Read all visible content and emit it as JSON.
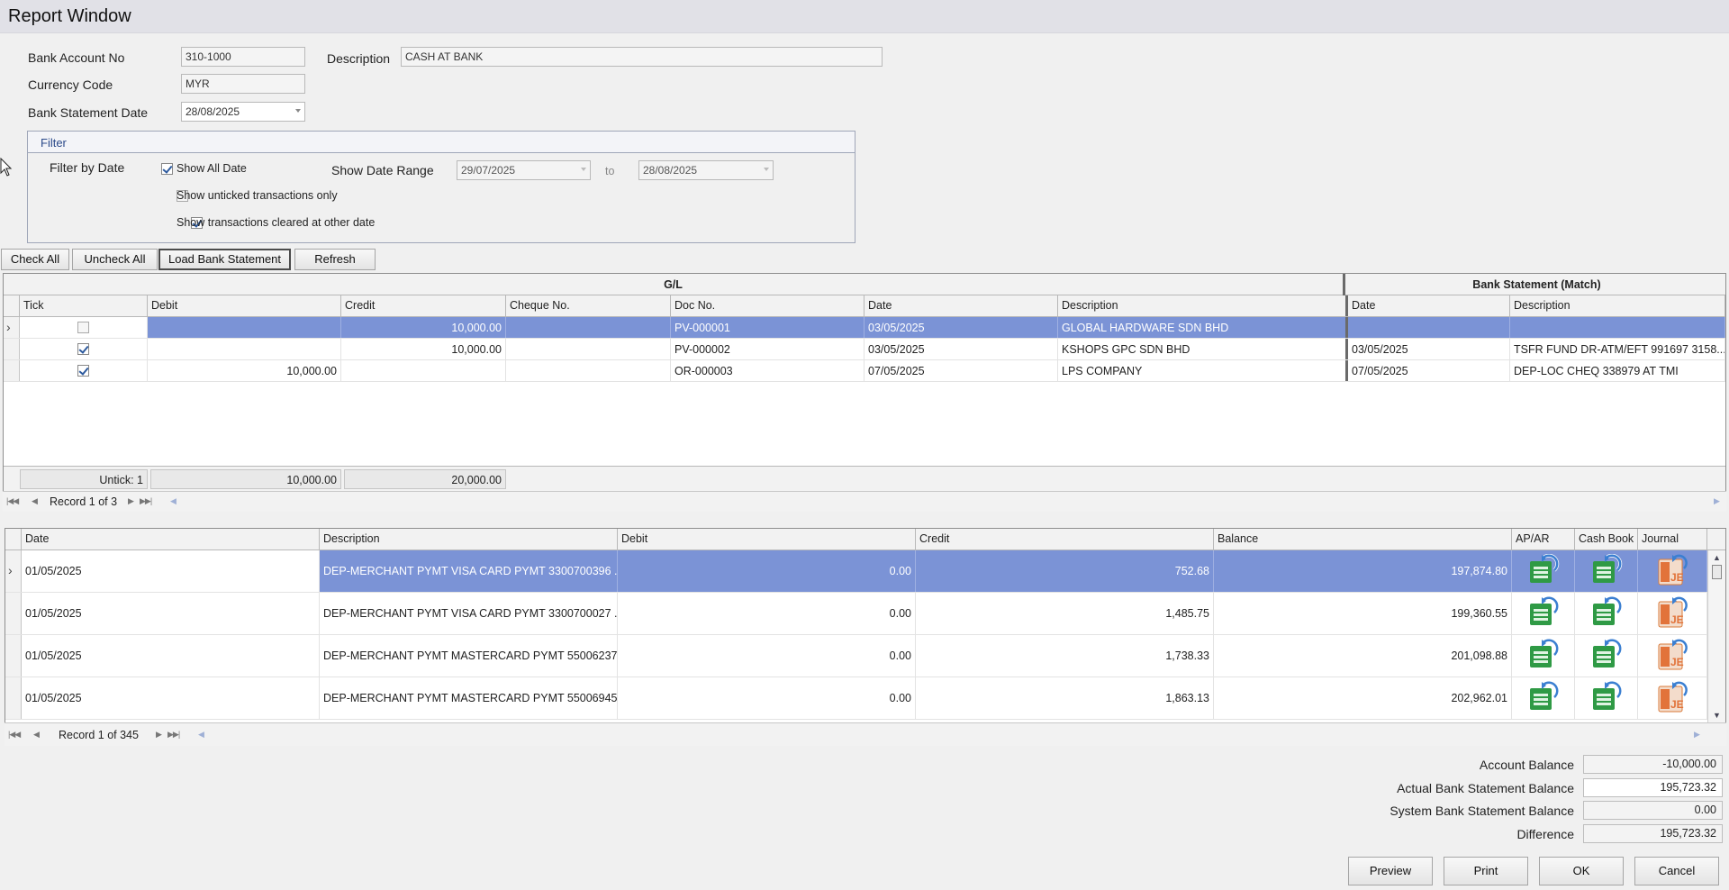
{
  "window": {
    "title": "Report   Window"
  },
  "header": {
    "bank_account_label": "Bank Account No",
    "bank_account_value": "310-1000",
    "description_label": "Description",
    "description_value": "CASH AT BANK",
    "currency_label": "Currency Code",
    "currency_value": "MYR",
    "statement_date_label": "Bank Statement Date",
    "statement_date_value": "28/08/2025"
  },
  "filter": {
    "title": "Filter",
    "filter_by_date_label": "Filter by Date",
    "show_all_date_label": "Show All Date",
    "show_all_date_checked": true,
    "show_date_range_label": "Show Date Range",
    "date_from": "29/07/2025",
    "to_label": "to",
    "date_to": "28/08/2025",
    "show_unticked_label": "Show unticked transactions only",
    "show_unticked_checked": false,
    "show_cleared_label": "Show transactions cleared at other date",
    "show_cleared_checked": true
  },
  "toolbar": {
    "check_all": "Check All",
    "uncheck_all": "Uncheck All",
    "load_bank_statement": "Load Bank Statement",
    "refresh": "Refresh"
  },
  "gl_grid": {
    "band_gl": "G/L",
    "band_bank": "Bank Statement (Match)",
    "columns": [
      "Tick",
      "Debit",
      "Credit",
      "Cheque No.",
      "Doc No.",
      "Date",
      "Description",
      "Date",
      "Description"
    ],
    "rows": [
      {
        "ticked": false,
        "debit": "",
        "credit": "10,000.00",
        "cheque": "",
        "doc": "PV-000001",
        "date": "03/05/2025",
        "desc": "GLOBAL HARDWARE SDN BHD",
        "bs_date": "",
        "bs_desc": ""
      },
      {
        "ticked": true,
        "debit": "",
        "credit": "10,000.00",
        "cheque": "",
        "doc": "PV-000002",
        "date": "03/05/2025",
        "desc": "KSHOPS GPC SDN BHD",
        "bs_date": "03/05/2025",
        "bs_desc": "TSFR FUND DR-ATM/EFT 991697 3158..."
      },
      {
        "ticked": true,
        "debit": "10,000.00",
        "credit": "",
        "cheque": "",
        "doc": "OR-000003",
        "date": "07/05/2025",
        "desc": "LPS COMPANY",
        "bs_date": "07/05/2025",
        "bs_desc": "DEP-LOC CHEQ 338979 AT TMI"
      }
    ],
    "footer": {
      "untick": "Untick: 1",
      "debit_total": "10,000.00",
      "credit_total": "20,000.00"
    },
    "record_text": "Record 1 of 3"
  },
  "bank_grid": {
    "columns": [
      "Date",
      "Description",
      "Debit",
      "Credit",
      "Balance",
      "AP/AR",
      "Cash Book",
      "Journal"
    ],
    "rows": [
      {
        "date": "01/05/2025",
        "desc": "DEP-MERCHANT PYMT VISA CARD PYMT 3300700396 ...",
        "debit": "0.00",
        "credit": "752.68",
        "balance": "197,874.80"
      },
      {
        "date": "01/05/2025",
        "desc": "DEP-MERCHANT PYMT VISA CARD PYMT 3300700027 ...",
        "debit": "0.00",
        "credit": "1,485.75",
        "balance": "199,360.55"
      },
      {
        "date": "01/05/2025",
        "desc": "DEP-MERCHANT PYMT MASTERCARD PYMT 55006237...",
        "debit": "0.00",
        "credit": "1,738.33",
        "balance": "201,098.88"
      },
      {
        "date": "01/05/2025",
        "desc": "DEP-MERCHANT PYMT MASTERCARD PYMT 55006945...",
        "debit": "0.00",
        "credit": "1,863.13",
        "balance": "202,962.01"
      }
    ],
    "record_text": "Record 1 of 345",
    "icon_journal_text": "JE"
  },
  "summary": {
    "account_balance_label": "Account Balance",
    "account_balance": "-10,000.00",
    "actual_bs_label": "Actual Bank Statement Balance",
    "actual_bs": "195,723.32",
    "system_bs_label": "System Bank Statement Balance",
    "system_bs": "0.00",
    "difference_label": "Difference",
    "difference": "195,723.32"
  },
  "footer_buttons": {
    "preview": "Preview",
    "print": "Print",
    "ok": "OK",
    "cancel": "Cancel"
  },
  "colors": {
    "selection": "#7b93d6",
    "title_bar": "#e1e1e7",
    "group_title": "#2b4a8a"
  }
}
